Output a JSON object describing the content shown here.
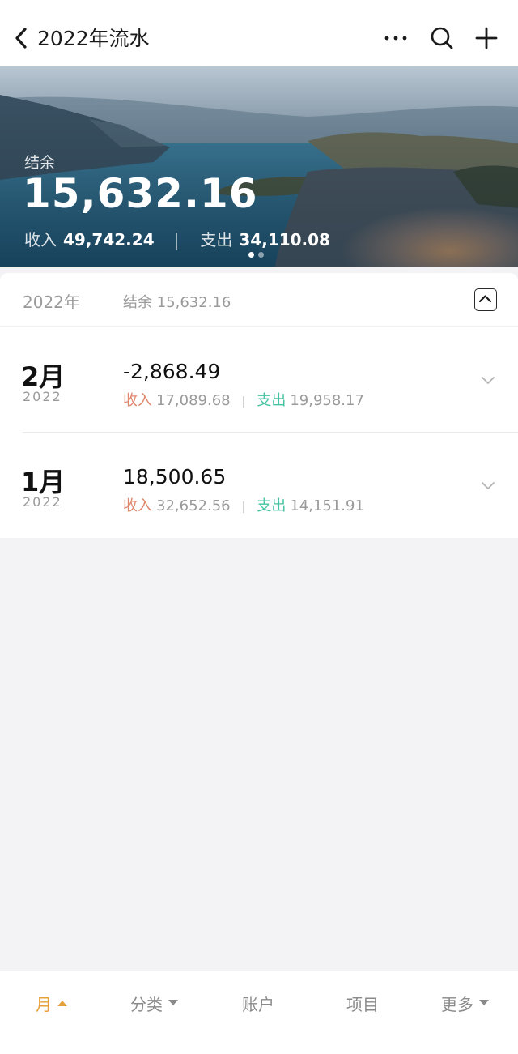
{
  "header": {
    "title": "2022年流水",
    "icons": [
      "back-icon",
      "more-icon",
      "search-icon",
      "add-icon"
    ]
  },
  "hero": {
    "balance_label": "结余",
    "balance": "15,632.16",
    "income_label": "收入",
    "income": "49,742.24",
    "separator": "|",
    "expense_label": "支出",
    "expense": "34,110.08",
    "carousel_pages": 2,
    "carousel_active": 1
  },
  "year": {
    "label": "2022年",
    "balance_text": "结余 15,632.16"
  },
  "months": [
    {
      "month": "2月",
      "year": "2022",
      "balance": "-2,868.49",
      "income_label": "收入",
      "income": "17,089.68",
      "separator": "|",
      "expense_label": "支出",
      "expense": "19,958.17"
    },
    {
      "month": "1月",
      "year": "2022",
      "balance": "18,500.65",
      "income_label": "收入",
      "income": "32,652.56",
      "separator": "|",
      "expense_label": "支出",
      "expense": "14,151.91"
    }
  ],
  "tabs": {
    "month": "月",
    "category": "分类",
    "account": "账户",
    "project": "项目",
    "more": "更多"
  },
  "colors": {
    "accent": "#e6a23a",
    "income": "#e0876e",
    "expense": "#45c3a2",
    "muted": "#9a9a9a",
    "background": "#f3f3f5"
  }
}
